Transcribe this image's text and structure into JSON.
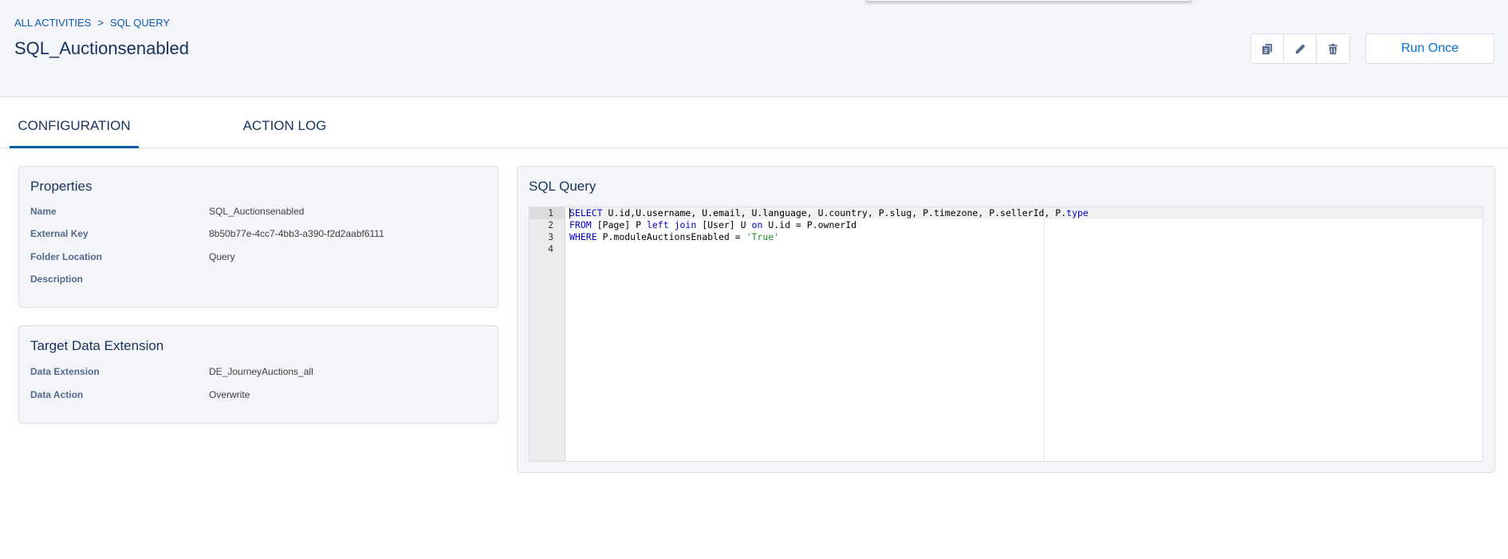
{
  "breadcrumb": {
    "root": "ALL ACTIVITIES",
    "separator": ">",
    "current": "SQL QUERY"
  },
  "page_title": "SQL_Auctionsenabled",
  "toolbar": {
    "copy_icon": "copy-icon",
    "edit_icon": "pencil-icon",
    "delete_icon": "trash-icon",
    "run_once_label": "Run Once"
  },
  "tabs": [
    {
      "label": "CONFIGURATION",
      "active": true
    },
    {
      "label": "ACTION LOG",
      "active": false
    }
  ],
  "properties": {
    "title": "Properties",
    "rows": [
      {
        "label": "Name",
        "value": "SQL_Auctionsenabled"
      },
      {
        "label": "External Key",
        "value": "8b50b77e-4cc7-4bb3-a390-f2d2aabf6111"
      },
      {
        "label": "Folder Location",
        "value": "Query"
      },
      {
        "label": "Description",
        "value": ""
      }
    ]
  },
  "target": {
    "title": "Target Data Extension",
    "rows": [
      {
        "label": "Data Extension",
        "value": "DE_JourneyAuctions_all"
      },
      {
        "label": "Data Action",
        "value": "Overwrite"
      }
    ]
  },
  "sql": {
    "title": "SQL Query",
    "line_numbers": [
      "1",
      "2",
      "3",
      "4"
    ],
    "lines": [
      [
        {
          "t": "SELECT",
          "k": "kw"
        },
        {
          "t": " U.id,U.username, U.email, U.language, U.country, P.slug, P.timezone, P.sellerId, P."
        },
        {
          "t": "type",
          "k": "kw"
        }
      ],
      [
        {
          "t": "FROM",
          "k": "kw"
        },
        {
          "t": " [Page] P "
        },
        {
          "t": "left join",
          "k": "kw"
        },
        {
          "t": " [User] U "
        },
        {
          "t": "on",
          "k": "kw"
        },
        {
          "t": " U.id = P.ownerId"
        }
      ],
      [
        {
          "t": "WHERE",
          "k": "kw"
        },
        {
          "t": " P.moduleAuctionsEnabled = "
        },
        {
          "t": "'True'",
          "k": "str"
        }
      ],
      []
    ]
  },
  "colors": {
    "accent": "#0b5cab",
    "keyword": "#0000cd",
    "string": "#228b22",
    "header_bg": "#f3f5f8"
  }
}
